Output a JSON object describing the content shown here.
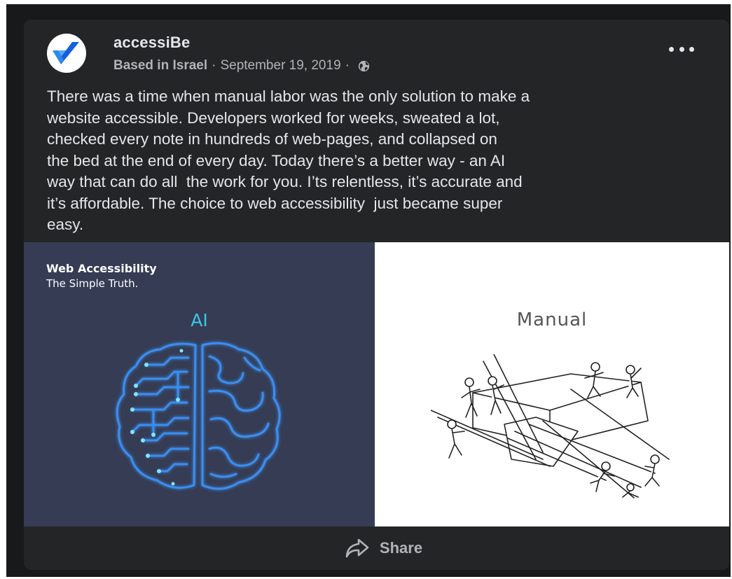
{
  "post": {
    "page_name": "accessiBe",
    "location": "Based in Israel",
    "date": "September 19, 2019",
    "separator": "·",
    "audience_icon": "globe-icon",
    "more_icon": "more-options-icon",
    "text": "There was a time when manual labor was the only solution to make a\nwebsite accessible. Developers worked for weeks, sweated a lot,\nchecked every note in hundreds of web-pages, and collapsed on\nthe bed at the end of every day. Today there’s a better way - an AI\nway that can do all  the work for you. I’ts relentless, it’s accurate and\nit’s affordable. The choice to web accessibility  just became super\neasy."
  },
  "image": {
    "title": "Web Accessibility",
    "subtitle": "The Simple Truth.",
    "left_label": "AI",
    "right_label": "Manual",
    "left_bg": "#353c54",
    "accent": "#3ec6e6"
  },
  "actions": {
    "share_label": "Share",
    "share_icon": "share-arrow-icon"
  },
  "colors": {
    "card_bg": "#242526",
    "text": "#e4e6eb",
    "muted": "#b0b3b8",
    "brand_blue": "#1877f2"
  }
}
